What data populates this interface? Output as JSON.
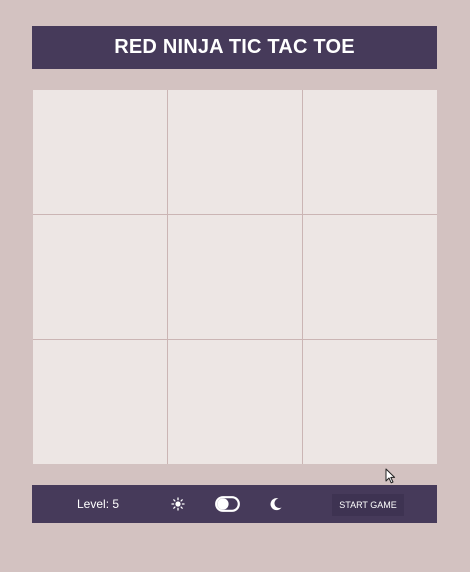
{
  "header": {
    "title": "RED NINJA TIC TAC TOE"
  },
  "board": {
    "cells": [
      "",
      "",
      "",
      "",
      "",
      "",
      "",
      "",
      ""
    ]
  },
  "footer": {
    "level_text": "Level: 5",
    "light_icon": "sun-icon",
    "toggle_icon": "theme-toggle",
    "dark_icon": "moon-icon",
    "start_button_label": "START GAME"
  },
  "colors": {
    "page_background": "#d3c2c1",
    "header_background": "#463a5a",
    "cell_background": "#ede6e4",
    "grid_lines": "#cbb5b4",
    "text": "#ffffff"
  }
}
